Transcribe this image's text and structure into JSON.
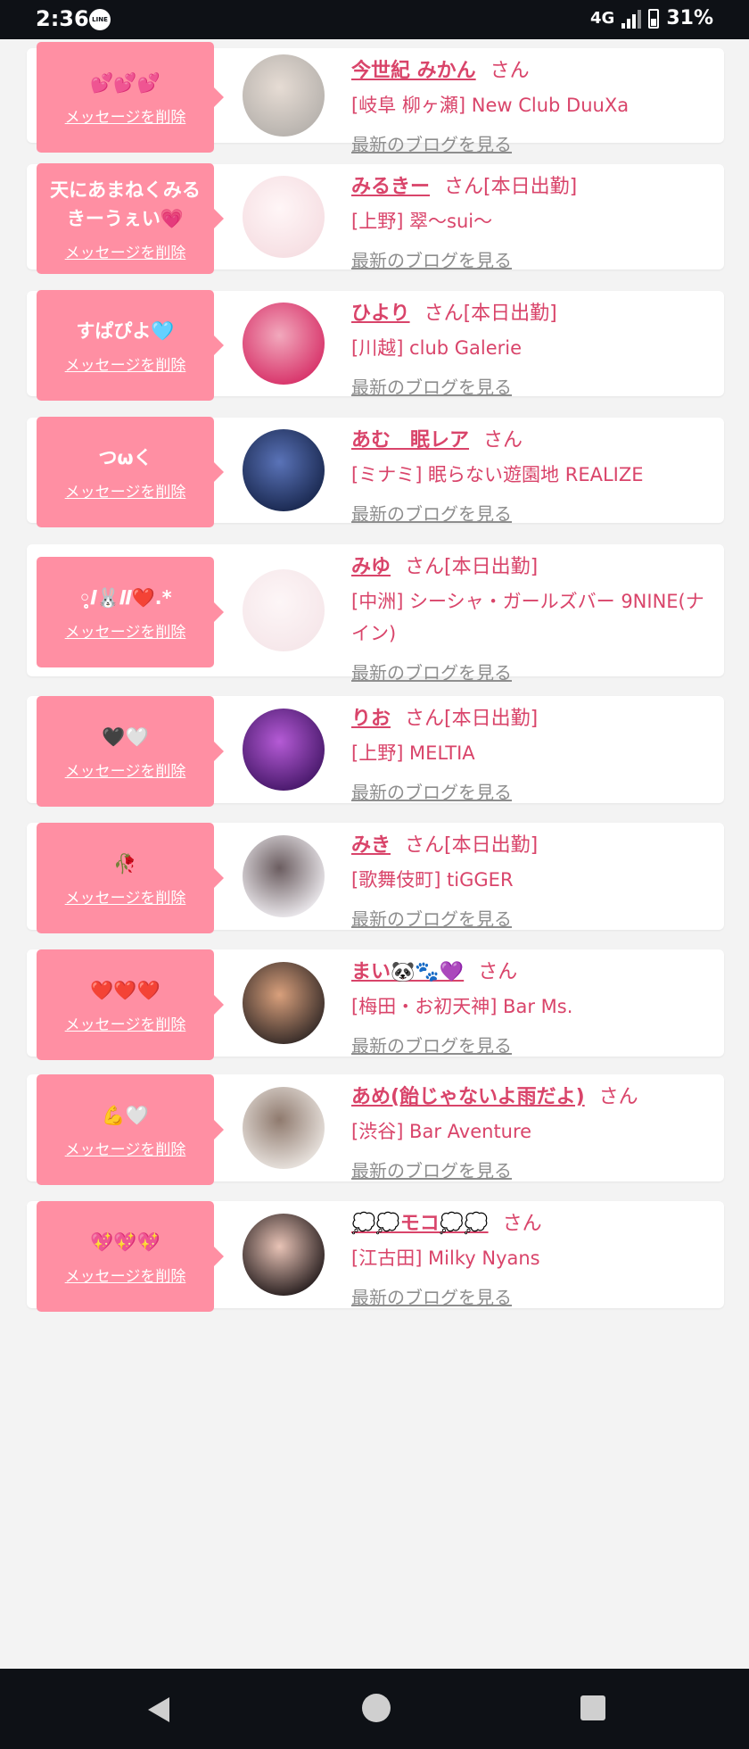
{
  "status_bar": {
    "time": "2:36",
    "app_icon": "LINE",
    "network": "4G",
    "battery": "31%"
  },
  "delete_label": "メッセージを削除",
  "blog_label": "最新のブログを見る",
  "honorific": "さん",
  "on_duty_label": "[本日出勤]",
  "items": [
    {
      "message": "💕💕💕",
      "name": "今世紀 みかん",
      "on_duty": false,
      "shop": "[岐阜 柳ヶ瀬] New Club DuuXa",
      "avatar_colors": [
        "#b8b3ae",
        "#e6dcd4"
      ]
    },
    {
      "message": "天にあまねくみるきーうぇい💗",
      "name": "みるきー",
      "on_duty": true,
      "shop": "[上野] 翠〜sui〜",
      "avatar_colors": [
        "#f6dfe3",
        "#fff6f7"
      ]
    },
    {
      "message": "すぱぴよ🩵",
      "name": "ひより",
      "on_duty": true,
      "shop": "[川越] club Galerie",
      "avatar_colors": [
        "#d8356b",
        "#f2a9bd"
      ]
    },
    {
      "message": "つωく",
      "name": "あむ　眠レア",
      "on_duty": false,
      "shop": "[ミナミ] 眠らない遊園地 REALIZE",
      "avatar_colors": [
        "#1b2a52",
        "#5a73b8"
      ]
    },
    {
      "message": "◦̥̥̥̥𝑰🐰𝑰𝑰❤️.*",
      "name": "みゆ",
      "on_duty": true,
      "shop": "[中洲] シーシャ・ガールズバー 9NINE(ナイン)",
      "avatar_colors": [
        "#f6e7ea",
        "#fdf6f7"
      ]
    },
    {
      "message": "🖤🤍",
      "name": "りお",
      "on_duty": true,
      "shop": "[上野] MELTIA",
      "avatar_colors": [
        "#4a1a6d",
        "#b55bd6"
      ]
    },
    {
      "message": "🥀",
      "name": "みき",
      "on_duty": true,
      "shop": "[歌舞伎町] tiGGER",
      "avatar_colors": [
        "#e9e6ea",
        "#6b5d60"
      ]
    },
    {
      "message": "❤️❤️❤️",
      "name": "まい🐼🐾💜",
      "on_duty": false,
      "shop": "[梅田・お初天神] Bar Ms.",
      "avatar_colors": [
        "#3a2e2a",
        "#d9a07c"
      ]
    },
    {
      "message": "💪🤍",
      "name": "あめ(飴じゃないよ雨だよ)",
      "on_duty": false,
      "shop": "[渋谷] Bar Aventure",
      "avatar_colors": [
        "#e7e1dc",
        "#8f7a6e"
      ]
    },
    {
      "message": "💖💖💖",
      "name": "💭💭モコ💭💭",
      "on_duty": false,
      "shop": "[江古田] Milky Nyans",
      "avatar_colors": [
        "#2d2323",
        "#e8c3b6"
      ]
    }
  ]
}
